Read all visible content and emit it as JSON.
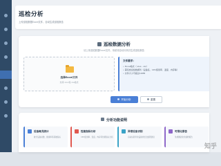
{
  "header": {
    "title": "巡检分析",
    "subtitle": "上传巡检数据Excel文件，自动生成巡检报告"
  },
  "upload_card": {
    "title": "巡检数据分析",
    "subtitle": "请上传巡检数据Excel文件，系统将自动分析并生成巡检报告",
    "dropzone": {
      "label": "选择Excel文件",
      "hint": "支持.xlsx和.xls格式"
    },
    "requirements": {
      "title": "文件要求：",
      "items": [
        "Excel格式（.xlsx, .xls）",
        "需包含巡检数据列（设备名、CPU使用率、温度、内存等）",
        "文件大小不超过10MB"
      ]
    },
    "start_button": "开始分析",
    "reset_button": "重置"
  },
  "features": {
    "title": "分析功能说明",
    "items": [
      {
        "name": "设备概况统计",
        "desc": "统计设备总数、健康率等基础指标",
        "icon": "chart-icon",
        "color": "#4a7fd6"
      },
      {
        "name": "性能指标分析",
        "desc": "CPU使用率、温度、内存等性能指标分析",
        "icon": "gauge-icon",
        "color": "#e0584f"
      },
      {
        "name": "异常设备识别",
        "desc": "自动识别异常设备并给出处理建议",
        "icon": "alert-icon",
        "color": "#3aa3c7"
      },
      {
        "name": "可视化报告",
        "desc": "生成图表化的巡检报告",
        "icon": "report-icon",
        "color": "#8e67c9"
      }
    ]
  },
  "watermark": "知乎"
}
